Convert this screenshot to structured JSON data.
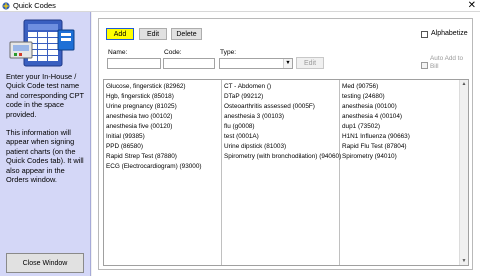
{
  "window": {
    "title": "Quick Codes",
    "close_glyph": "✕"
  },
  "sidebar": {
    "art_icon": "spreadsheet-document-icon",
    "instructions": "Enter your In-House / Quick Code test name and corresponding CPT code in the space provided.",
    "notice": "This information will appear when signing patient charts (on the Quick Codes tab). It will also appear in the Orders window.",
    "close_button": "Close Window"
  },
  "toolbar": {
    "add_label": "Add",
    "edit_label": "Edit",
    "delete_label": "Delete"
  },
  "options": {
    "alphabetize_label": "Alphabetize",
    "alphabetize_checked": false,
    "auto_add_label": "Auto Add to Bill",
    "auto_add_checked": false
  },
  "form": {
    "name_label": "Name:",
    "code_label": "Code:",
    "type_label": "Type:",
    "name_value": "",
    "code_value": "",
    "type_value": "",
    "edit_label": "Edit"
  },
  "list": {
    "columns": [
      [
        "Glucose, fingerstick  (82962)",
        "Hgb, fingerstick  (85018)",
        "Urine pregnancy  (81025)",
        "anesthesia two  (00102)",
        "anesthesia five  (00120)",
        "Initial  (99385)",
        "PPD  (86580)",
        "Rapid Strep Test  (87880)",
        "ECG (Electrocardiogram)  (93000)"
      ],
      [
        "CT - Abdomen  ()",
        "DTaP  (99212)",
        "Osteoarthritis assessed  (0005F)",
        "anesthesia 3  (00103)",
        "flu  (g0008)",
        "test  (0001A)",
        "Urine dipstick  (81003)",
        "Spirometry (with bronchodilation)  (94060)"
      ],
      [
        "Med  (90756)",
        "testing  (24680)",
        "anesthesia  (00100)",
        "anesthesia 4  (00104)",
        "dup1  (73502)",
        "H1N1 Influenza  (90663)",
        "Rapid Flu Test  (87804)",
        "Spirometry  (94010)"
      ]
    ]
  },
  "colors": {
    "sidebar_bg": "#d4d7f7",
    "add_button_bg": "#ffff00",
    "add_button_border": "#1e5ad6"
  }
}
